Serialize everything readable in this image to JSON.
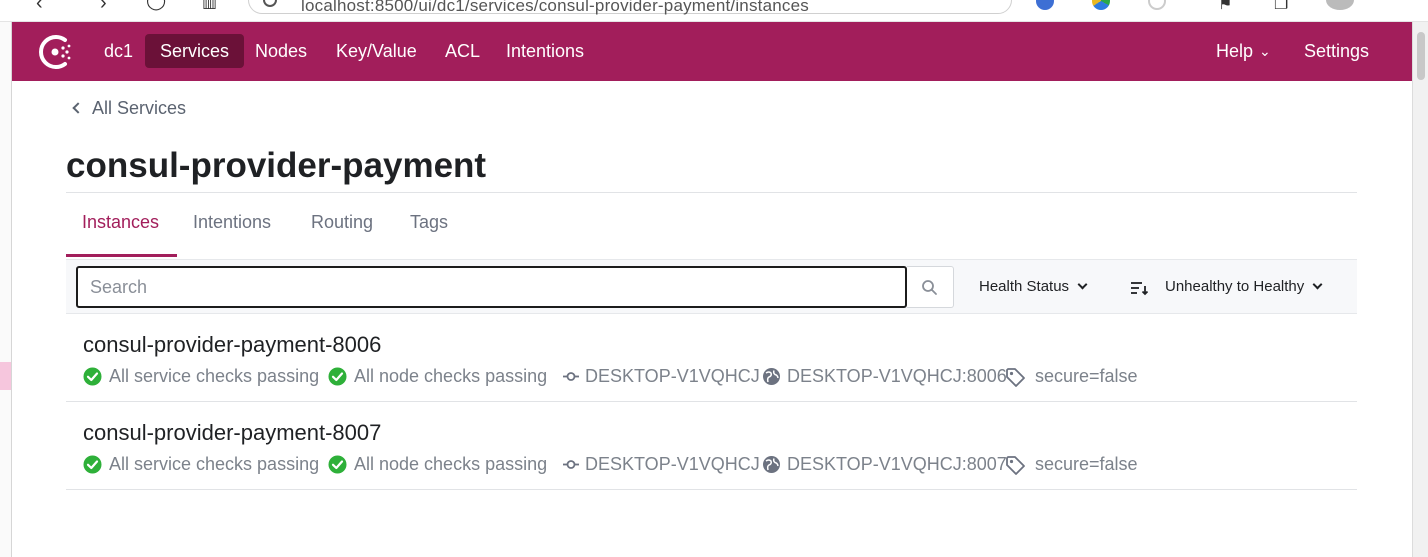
{
  "browser": {
    "url": "localhost:8500/ui/dc1/services/consul-provider-payment/instances"
  },
  "nav": {
    "datacenter": "dc1",
    "items": [
      "Services",
      "Nodes",
      "Key/Value",
      "ACL",
      "Intentions"
    ],
    "active": "Services",
    "help_label": "Help",
    "settings_label": "Settings"
  },
  "breadcrumb": {
    "label": "All Services"
  },
  "service": {
    "title": "consul-provider-payment"
  },
  "tabs": [
    "Instances",
    "Intentions",
    "Routing",
    "Tags"
  ],
  "active_tab": "Instances",
  "filters": {
    "search_placeholder": "Search",
    "health_status_label": "Health Status",
    "sort_label": "Unhealthy to Healthy"
  },
  "instances": [
    {
      "name": "consul-provider-payment-8006",
      "service_checks": "All service checks passing",
      "node_checks": "All node checks passing",
      "node": "DESKTOP-V1VQHCJ",
      "address": "DESKTOP-V1VQHCJ:8006",
      "tag": "secure=false"
    },
    {
      "name": "consul-provider-payment-8007",
      "service_checks": "All service checks passing",
      "node_checks": "All node checks passing",
      "node": "DESKTOP-V1VQHCJ",
      "address": "DESKTOP-V1VQHCJ:8007",
      "tag": "secure=false"
    }
  ],
  "colors": {
    "brand": "#a21e5b",
    "brand_active": "#6b1138",
    "passing": "#2eb039",
    "muted_text": "#7c828b"
  },
  "icons": [
    "consul-logo-icon",
    "search-icon",
    "sort-icon",
    "check-circle-icon",
    "node-icon",
    "globe-icon",
    "tag-icon"
  ]
}
